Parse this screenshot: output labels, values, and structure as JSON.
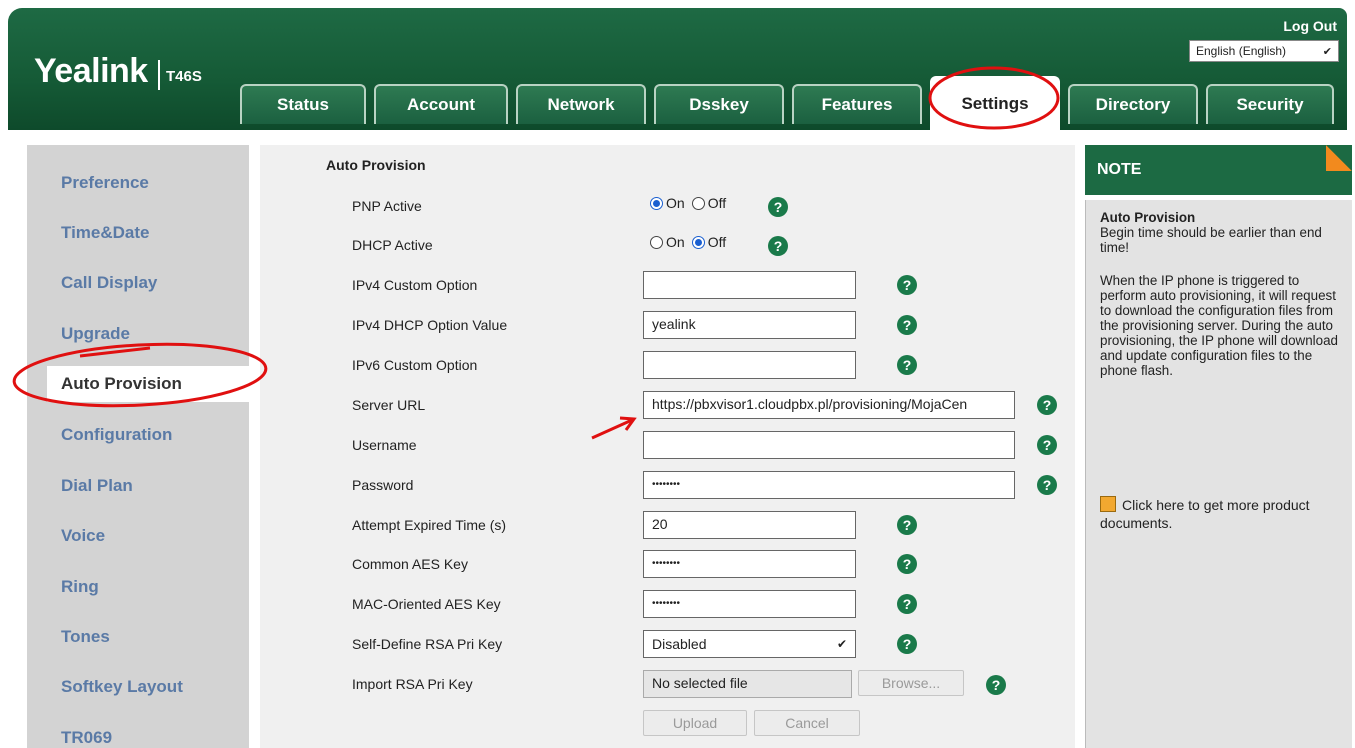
{
  "header": {
    "logo": "Yealink",
    "model": "T46S",
    "logout": "Log Out",
    "language": "English (English)"
  },
  "tabs": [
    {
      "label": "Status"
    },
    {
      "label": "Account"
    },
    {
      "label": "Network"
    },
    {
      "label": "Dsskey"
    },
    {
      "label": "Features"
    },
    {
      "label": "Settings",
      "active": true
    },
    {
      "label": "Directory"
    },
    {
      "label": "Security"
    }
  ],
  "sidebar": {
    "items": [
      {
        "label": "Preference"
      },
      {
        "label": "Time&Date"
      },
      {
        "label": "Call Display"
      },
      {
        "label": "Upgrade"
      },
      {
        "label": "Auto Provision",
        "active": true
      },
      {
        "label": "Configuration"
      },
      {
        "label": "Dial Plan"
      },
      {
        "label": "Voice"
      },
      {
        "label": "Ring"
      },
      {
        "label": "Tones"
      },
      {
        "label": "Softkey Layout"
      },
      {
        "label": "TR069"
      }
    ]
  },
  "form": {
    "title": "Auto Provision",
    "pnp_active": {
      "label": "PNP Active",
      "on": "On",
      "off": "Off",
      "selected": "On"
    },
    "dhcp_active": {
      "label": "DHCP Active",
      "on": "On",
      "off": "Off",
      "selected": "Off"
    },
    "ipv4_custom_option": {
      "label": "IPv4 Custom Option",
      "value": ""
    },
    "ipv4_dhcp_option_value": {
      "label": "IPv4 DHCP Option Value",
      "value": "yealink"
    },
    "ipv6_custom_option": {
      "label": "IPv6 Custom Option",
      "value": ""
    },
    "server_url": {
      "label": "Server URL",
      "value": "https://pbxvisor1.cloudpbx.pl/provisioning/MojaCen"
    },
    "username": {
      "label": "Username",
      "value": ""
    },
    "password": {
      "label": "Password",
      "value": "••••••••"
    },
    "attempt_expired_time": {
      "label": "Attempt Expired Time (s)",
      "value": "20"
    },
    "common_aes_key": {
      "label": "Common AES Key",
      "value": "••••••••"
    },
    "mac_oriented_aes_key": {
      "label": "MAC-Oriented AES Key",
      "value": "••••••••"
    },
    "self_define_rsa": {
      "label": "Self-Define RSA Pri Key",
      "value": "Disabled"
    },
    "import_rsa": {
      "label": "Import RSA Pri Key",
      "file": "No selected file",
      "browse": "Browse..."
    },
    "upload": "Upload",
    "cancel": "Cancel",
    "help_glyph": "?"
  },
  "note": {
    "heading": "NOTE",
    "title": "Auto Provision",
    "line1": "Begin time should be earlier than end time!",
    "line2": "When the IP phone is triggered to perform auto provisioning, it will request to download the configuration files from the provisioning server. During the auto provisioning, the IP phone will download and update configuration files to the phone flash.",
    "doc_link": "Click here to get more product documents."
  },
  "colors": {
    "brand_green": "#155a36",
    "annotation_red": "#e01010",
    "sidebar_link": "#5a7aa6"
  }
}
